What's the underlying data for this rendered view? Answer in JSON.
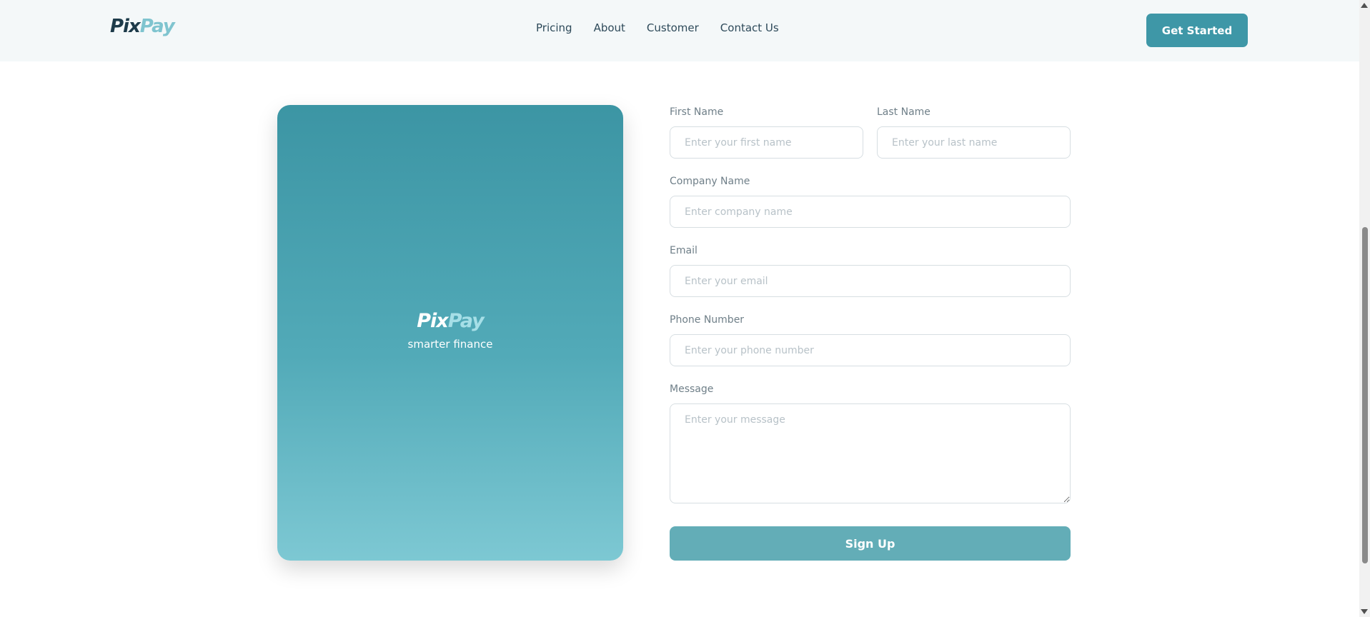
{
  "nav": {
    "logo": {
      "part1": "Pix",
      "part2": "Pay"
    },
    "links": [
      "Pricing",
      "About",
      "Customer",
      "Contact Us"
    ],
    "cta_label": "Get Started"
  },
  "hero": {
    "logo": {
      "part1": "Pix",
      "part2": "Pay"
    },
    "tagline": "smarter finance"
  },
  "form": {
    "first_name": {
      "label": "First Name",
      "placeholder": "Enter your first name"
    },
    "last_name": {
      "label": "Last Name",
      "placeholder": "Enter your last name"
    },
    "company": {
      "label": "Company Name",
      "placeholder": "Enter company name"
    },
    "email": {
      "label": "Email",
      "placeholder": "Enter your email"
    },
    "phone": {
      "label": "Phone Number",
      "placeholder": "Enter your phone number"
    },
    "message": {
      "label": "Message",
      "placeholder": "Enter your message"
    },
    "submit_label": "Sign Up"
  },
  "colors": {
    "brand_primary": "#3e97a7",
    "brand_light": "#7fc4cf",
    "brand_dark": "#1d3b4a",
    "submit_button": "#63adb7"
  }
}
